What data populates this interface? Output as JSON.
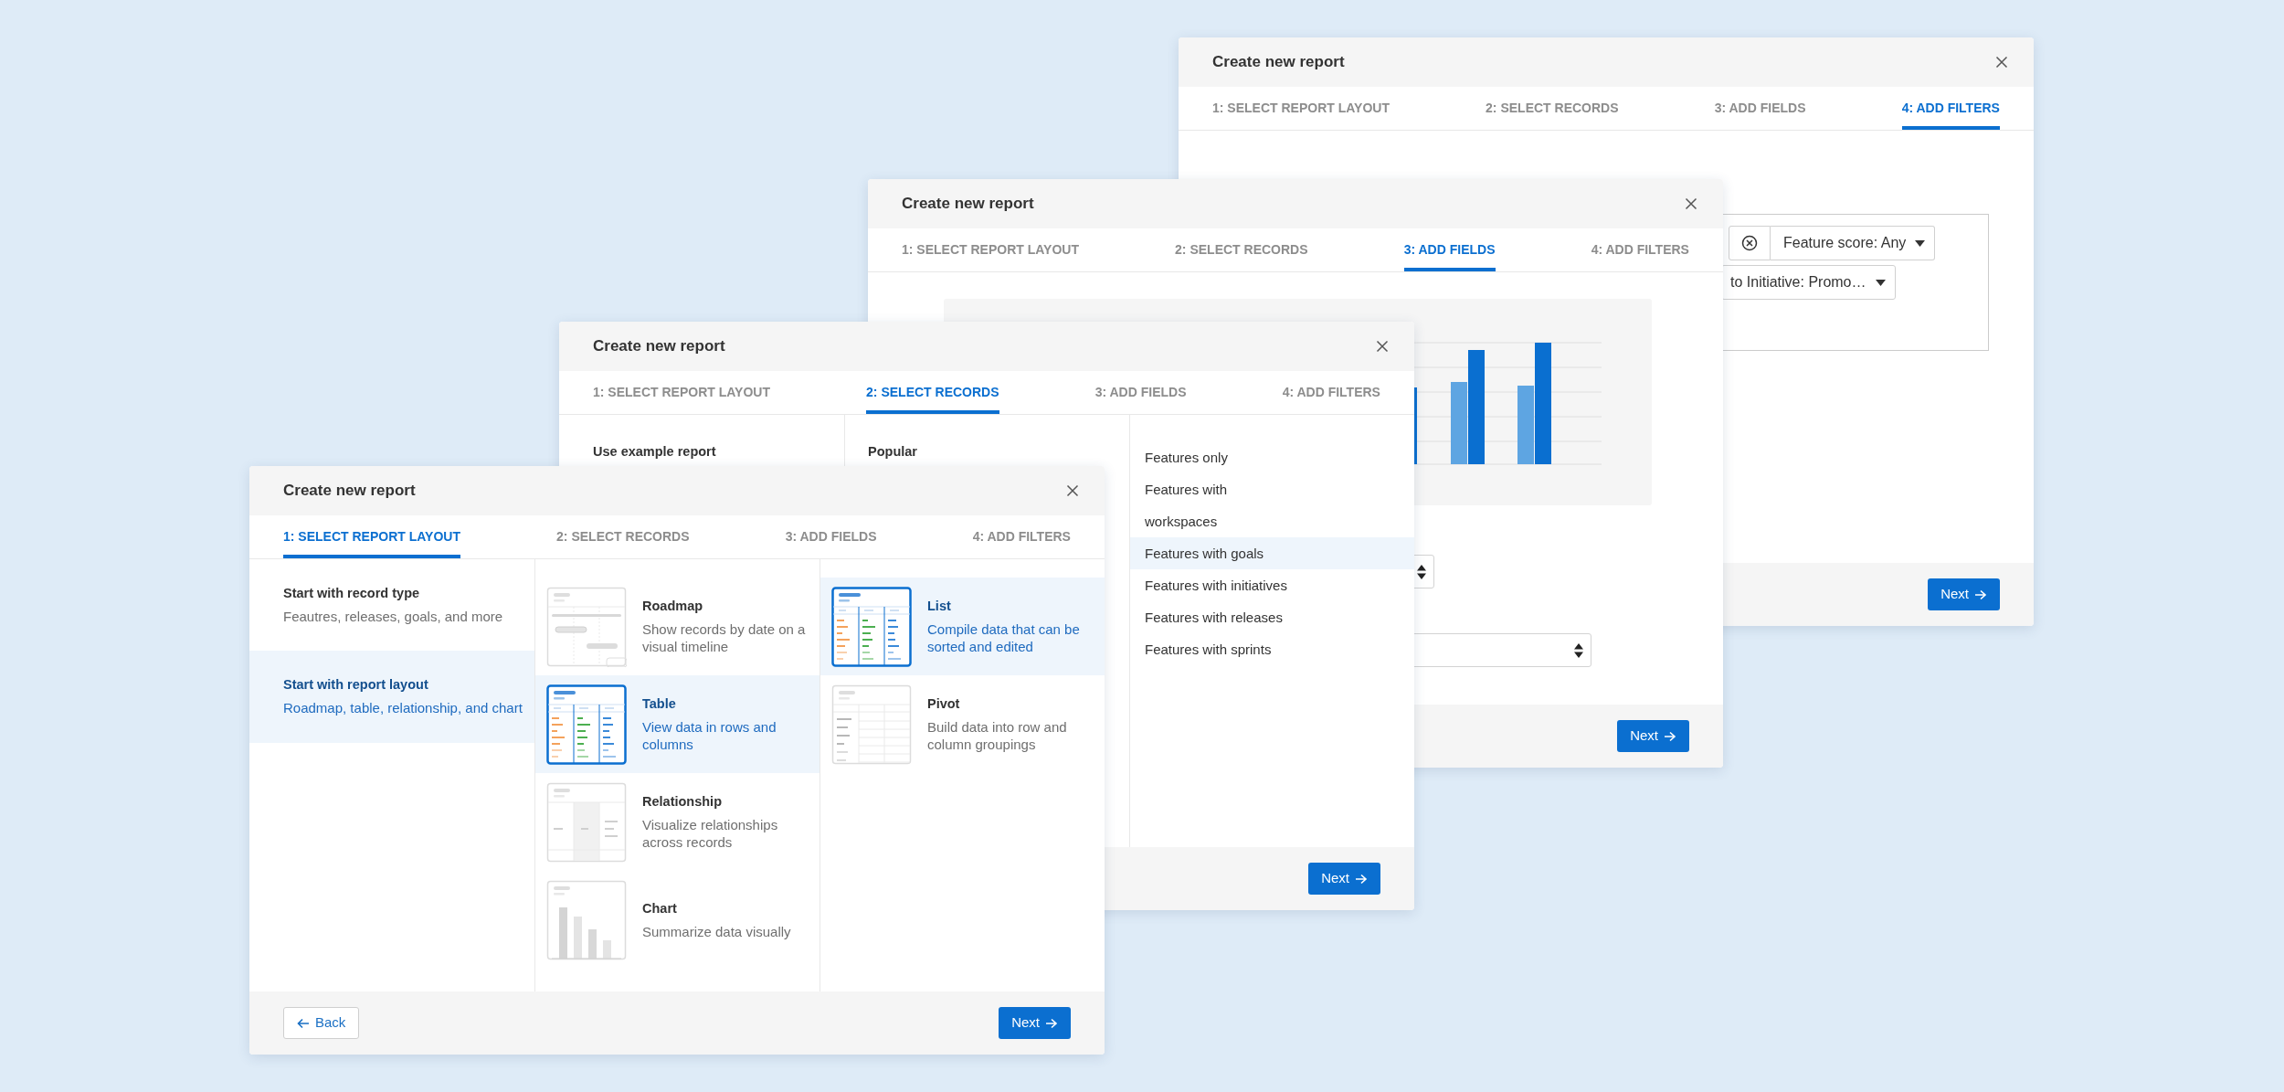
{
  "dialogs": [
    {
      "kind": "filters",
      "title": "Create new report",
      "tabs": [
        {
          "label": "1: SELECT REPORT LAYOUT",
          "selected": false
        },
        {
          "label": "2: SELECT RECORDS",
          "selected": false
        },
        {
          "label": "3: ADD FIELDS",
          "selected": false
        },
        {
          "label": "4: ADD FILTERS",
          "selected": true
        }
      ],
      "filters": [
        {
          "kind": "chip",
          "label": "Feature score: Any"
        },
        {
          "kind": "dropdown",
          "label": "to Initiative: Promo…"
        }
      ],
      "primary_button": "Next"
    },
    {
      "kind": "fields",
      "title": "Create new report",
      "tabs": [
        {
          "label": "1: SELECT REPORT LAYOUT",
          "selected": false
        },
        {
          "label": "2: SELECT RECORDS",
          "selected": false
        },
        {
          "label": "3: ADD FIELDS",
          "selected": true
        },
        {
          "label": "4: ADD FILTERS",
          "selected": false
        }
      ],
      "primary_button": "Next"
    },
    {
      "kind": "records",
      "title": "Create new report",
      "tabs": [
        {
          "label": "1: SELECT REPORT LAYOUT",
          "selected": false
        },
        {
          "label": "2: SELECT RECORDS",
          "selected": true
        },
        {
          "label": "3: ADD FIELDS",
          "selected": false
        },
        {
          "label": "4: ADD FILTERS",
          "selected": false
        }
      ],
      "sections": [
        {
          "heading": "Use example report"
        },
        {
          "heading": "Popular"
        }
      ],
      "record_types": [
        {
          "label": "Features only",
          "selected": false
        },
        {
          "label": "Features with",
          "selected": false
        },
        {
          "label": "workspaces",
          "selected": false
        },
        {
          "label": "Features with goals",
          "selected": true
        },
        {
          "label": "Features with initiatives",
          "selected": false
        },
        {
          "label": "Features with releases",
          "selected": false
        },
        {
          "label": "Features with sprints",
          "selected": false
        }
      ],
      "primary_button": "Next"
    },
    {
      "kind": "layout",
      "title": "Create new report",
      "tabs": [
        {
          "label": "1: SELECT REPORT LAYOUT",
          "selected": true
        },
        {
          "label": "2: SELECT RECORDS",
          "selected": false
        },
        {
          "label": "3: ADD FIELDS",
          "selected": false
        },
        {
          "label": "4: ADD FILTERS",
          "selected": false
        }
      ],
      "start_options": [
        {
          "title": "Start with record type",
          "description": "Feautres, releases, goals, and more",
          "selected": false
        },
        {
          "title": "Start with report layout",
          "description": "Roadmap, table, relationship, and chart",
          "selected": true
        }
      ],
      "layout_columns": [
        {
          "items": [
            {
              "kind": "roadmap",
              "title": "Roadmap",
              "description": "Show records by date on a visual timeline",
              "selected": false
            },
            {
              "kind": "table",
              "title": "Table",
              "description": "View data in rows and columns",
              "selected": true
            },
            {
              "kind": "relationship",
              "title": "Relationship",
              "description": "Visualize relationships across records",
              "selected": false
            },
            {
              "kind": "chart",
              "title": "Chart",
              "description": "Summarize data visually",
              "selected": false
            }
          ]
        },
        {
          "items": [
            {
              "kind": "list",
              "title": "List",
              "description": "Compile data that can be sorted and edited",
              "selected": true
            },
            {
              "kind": "pivot",
              "title": "Pivot",
              "description": "Build data into row and column groupings",
              "selected": false
            }
          ]
        }
      ],
      "back_button": "Back",
      "primary_button": "Next"
    }
  ]
}
